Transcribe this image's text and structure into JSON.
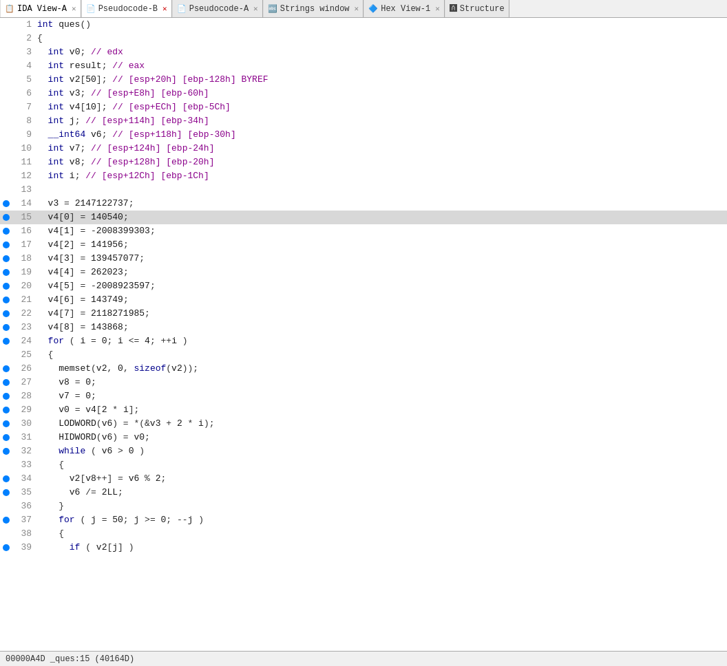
{
  "tabs": [
    {
      "id": "ida-view-a",
      "icon": "📋",
      "label": "IDA View-A",
      "closable": true,
      "active": false
    },
    {
      "id": "pseudocode-b",
      "icon": "📄",
      "label": "Pseudocode-B",
      "closable": true,
      "active": true
    },
    {
      "id": "pseudocode-a",
      "icon": "📄",
      "label": "Pseudocode-A",
      "closable": true,
      "active": false
    },
    {
      "id": "strings-window",
      "icon": "🔤",
      "label": "Strings window",
      "closable": true,
      "active": false
    },
    {
      "id": "hex-view-1",
      "icon": "🔷",
      "label": "Hex View-1",
      "closable": true,
      "active": false
    },
    {
      "id": "structures",
      "icon": "🅰",
      "label": "Structure",
      "closable": false,
      "active": false
    }
  ],
  "status_bar": {
    "text": "00000A4D _ques:15 (40164D)"
  },
  "code_lines": [
    {
      "num": 1,
      "bp": false,
      "hl": false,
      "text": "int ques()"
    },
    {
      "num": 2,
      "bp": false,
      "hl": false,
      "text": "{"
    },
    {
      "num": 3,
      "bp": false,
      "hl": false,
      "text": "  int v0; // edx"
    },
    {
      "num": 4,
      "bp": false,
      "hl": false,
      "text": "  int result; // eax"
    },
    {
      "num": 5,
      "bp": false,
      "hl": false,
      "text": "  int v2[50]; // [esp+20h] [ebp-128h] BYREF"
    },
    {
      "num": 6,
      "bp": false,
      "hl": false,
      "text": "  int v3; // [esp+E8h] [ebp-60h]"
    },
    {
      "num": 7,
      "bp": false,
      "hl": false,
      "text": "  int v4[10]; // [esp+ECh] [ebp-5Ch]"
    },
    {
      "num": 8,
      "bp": false,
      "hl": false,
      "text": "  int j; // [esp+114h] [ebp-34h]"
    },
    {
      "num": 9,
      "bp": false,
      "hl": false,
      "text": "  __int64 v6; // [esp+118h] [ebp-30h]"
    },
    {
      "num": 10,
      "bp": false,
      "hl": false,
      "text": "  int v7; // [esp+124h] [ebp-24h]"
    },
    {
      "num": 11,
      "bp": false,
      "hl": false,
      "text": "  int v8; // [esp+128h] [ebp-20h]"
    },
    {
      "num": 12,
      "bp": false,
      "hl": false,
      "text": "  int i; // [esp+12Ch] [ebp-1Ch]"
    },
    {
      "num": 13,
      "bp": false,
      "hl": false,
      "text": ""
    },
    {
      "num": 14,
      "bp": true,
      "hl": false,
      "text": "  v3 = 2147122737;"
    },
    {
      "num": 15,
      "bp": true,
      "hl": true,
      "text": "  v4[0] = 140540;"
    },
    {
      "num": 16,
      "bp": true,
      "hl": false,
      "text": "  v4[1] = -2008399303;"
    },
    {
      "num": 17,
      "bp": true,
      "hl": false,
      "text": "  v4[2] = 141956;"
    },
    {
      "num": 18,
      "bp": true,
      "hl": false,
      "text": "  v4[3] = 139457077;"
    },
    {
      "num": 19,
      "bp": true,
      "hl": false,
      "text": "  v4[4] = 262023;"
    },
    {
      "num": 20,
      "bp": true,
      "hl": false,
      "text": "  v4[5] = -2008923597;"
    },
    {
      "num": 21,
      "bp": true,
      "hl": false,
      "text": "  v4[6] = 143749;"
    },
    {
      "num": 22,
      "bp": true,
      "hl": false,
      "text": "  v4[7] = 2118271985;"
    },
    {
      "num": 23,
      "bp": true,
      "hl": false,
      "text": "  v4[8] = 143868;"
    },
    {
      "num": 24,
      "bp": true,
      "hl": false,
      "text": "  for ( i = 0; i <= 4; ++i )"
    },
    {
      "num": 25,
      "bp": false,
      "hl": false,
      "text": "  {"
    },
    {
      "num": 26,
      "bp": true,
      "hl": false,
      "text": "    memset(v2, 0, sizeof(v2));"
    },
    {
      "num": 27,
      "bp": true,
      "hl": false,
      "text": "    v8 = 0;"
    },
    {
      "num": 28,
      "bp": true,
      "hl": false,
      "text": "    v7 = 0;"
    },
    {
      "num": 29,
      "bp": true,
      "hl": false,
      "text": "    v0 = v4[2 * i];"
    },
    {
      "num": 30,
      "bp": true,
      "hl": false,
      "text": "    LODWORD(v6) = *(&v3 + 2 * i);"
    },
    {
      "num": 31,
      "bp": true,
      "hl": false,
      "text": "    HIDWORD(v6) = v0;"
    },
    {
      "num": 32,
      "bp": true,
      "hl": false,
      "text": "    while ( v6 > 0 )"
    },
    {
      "num": 33,
      "bp": false,
      "hl": false,
      "text": "    {"
    },
    {
      "num": 34,
      "bp": true,
      "hl": false,
      "text": "      v2[v8++] = v6 % 2;"
    },
    {
      "num": 35,
      "bp": true,
      "hl": false,
      "text": "      v6 /= 2LL;"
    },
    {
      "num": 36,
      "bp": false,
      "hl": false,
      "text": "    }"
    },
    {
      "num": 37,
      "bp": true,
      "hl": false,
      "text": "    for ( j = 50; j >= 0; --j )"
    },
    {
      "num": 38,
      "bp": false,
      "hl": false,
      "text": "    {"
    },
    {
      "num": 39,
      "bp": true,
      "hl": false,
      "text": "      if ( v2[j] )"
    }
  ]
}
